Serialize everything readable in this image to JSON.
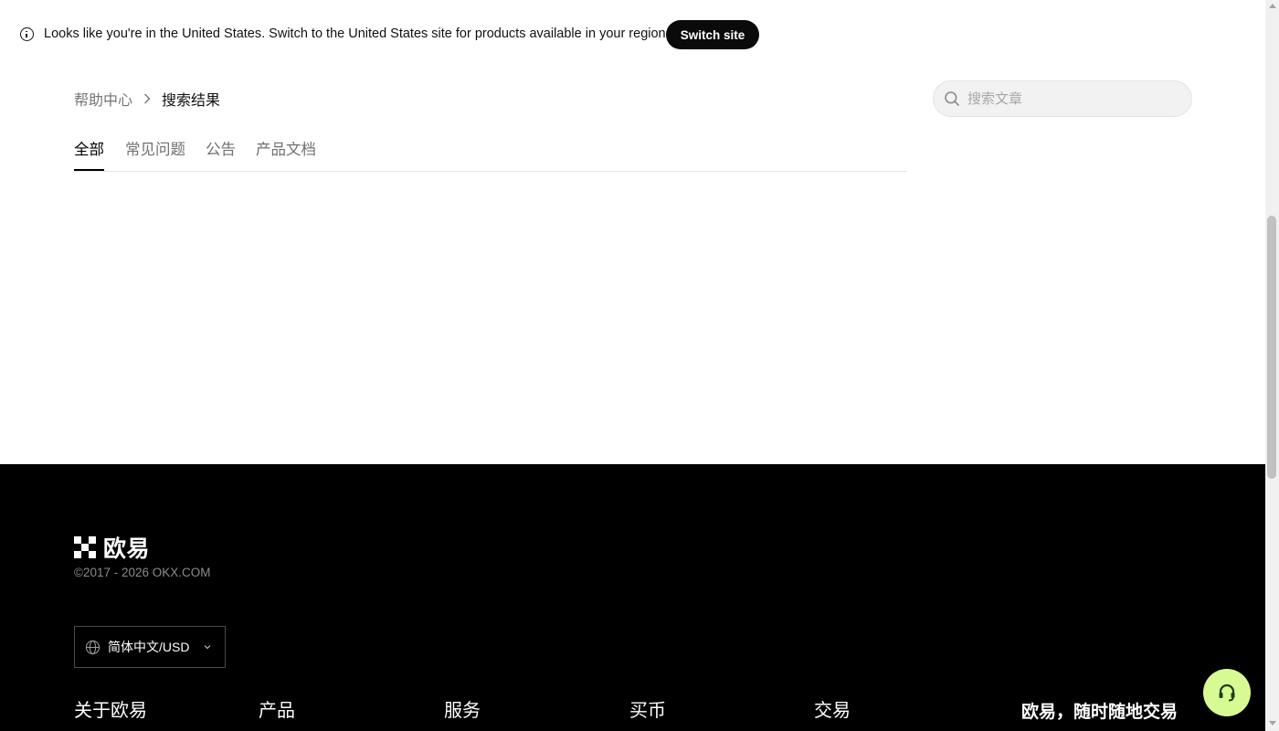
{
  "banner": {
    "message": "Looks like you're in the United States. Switch to the United States site for products available in your region.",
    "switch_label": "Switch site"
  },
  "breadcrumb": {
    "home": "帮助中心",
    "current": "搜索结果"
  },
  "search": {
    "placeholder": "搜索文章",
    "value": ""
  },
  "tabs": [
    {
      "label": "全部",
      "active": true
    },
    {
      "label": "常见问题",
      "active": false
    },
    {
      "label": "公告",
      "active": false
    },
    {
      "label": "产品文档",
      "active": false
    }
  ],
  "footer": {
    "logo_text": "欧易",
    "copyright": "©2017 - 2026 OKX.COM",
    "language": "简体中文/USD",
    "columns": [
      {
        "label": "关于欧易"
      },
      {
        "label": "产品"
      },
      {
        "label": "服务"
      },
      {
        "label": "买币"
      },
      {
        "label": "交易"
      }
    ],
    "slogan": "欧易，随时随地交易"
  },
  "colors": {
    "footer_bg": "#000000",
    "accent_support": "#d8fa92",
    "button_dark": "#0a0a0a"
  },
  "icons": {
    "banner": "info-icon",
    "search": "search-icon",
    "language": "globe-icon",
    "support": "headset-icon"
  }
}
